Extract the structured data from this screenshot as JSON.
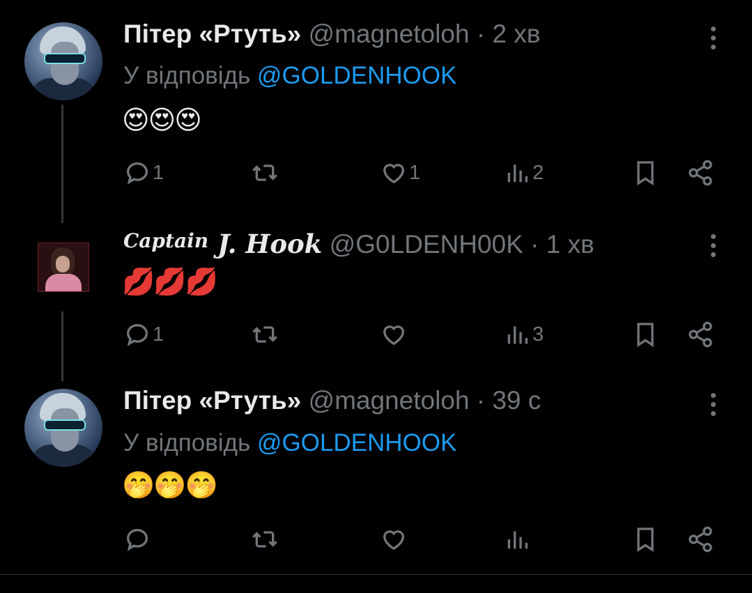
{
  "tweets": [
    {
      "name": "Пітер «Ртуть»",
      "handle": "@magnetoloh",
      "time": "· 2 хв",
      "reply_prefix": "У відповідь ",
      "reply_to": "@GOLDENHOOK",
      "emojis": "😍😍😍",
      "replies": "1",
      "retweets": "",
      "likes": "1",
      "views": "2"
    },
    {
      "name_part1": "Captain",
      "name_part2": " J. Hook",
      "handle": "@G0LDENH00K",
      "time": "· 1 хв",
      "emojis": "💋💋💋",
      "replies": "1",
      "retweets": "",
      "likes": "",
      "views": "3"
    },
    {
      "name": "Пітер «Ртуть»",
      "handle": "@magnetoloh",
      "time": "· 39 с",
      "reply_prefix": "У відповідь ",
      "reply_to": "@GOLDENHOOK",
      "emojis": "🤭🤭🤭",
      "replies": "",
      "retweets": "",
      "likes": "",
      "views": ""
    }
  ],
  "icons": {
    "reply": "speech-bubble-icon",
    "retweet": "retweet-icon",
    "like": "heart-icon",
    "views": "bar-chart-icon",
    "bookmark": "bookmark-icon",
    "share": "share-icon",
    "more": "more-vertical-icon"
  },
  "colors": {
    "background": "#000000",
    "text": "#e7e9ea",
    "muted": "#71767b",
    "accent": "#1d9bf0"
  }
}
